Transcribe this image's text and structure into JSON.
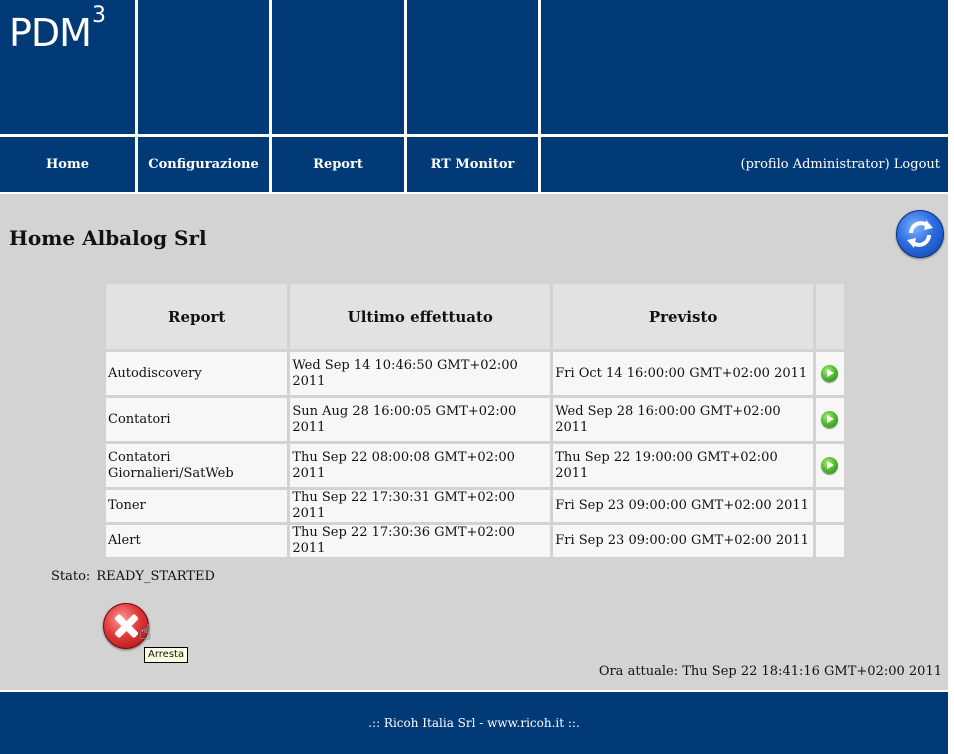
{
  "header": {
    "logo_main": "PDM",
    "logo_sup": "3"
  },
  "nav": {
    "home": "Home",
    "configurazione": "Configurazione",
    "report": "Report",
    "rt_monitor": "RT Monitor",
    "profile_text": "(profilo Administrator) ",
    "logout": "Logout"
  },
  "page": {
    "title": "Home Albalog Srl",
    "refresh_icon": "refresh-icon"
  },
  "table": {
    "columns": [
      "Report",
      "Ultimo effettuato",
      "Previsto",
      ""
    ],
    "rows": [
      {
        "report": "Autodiscovery",
        "ultimo": "Wed Sep 14 10:46:50 GMT+02:00 2011",
        "previsto": "Fri Oct 14 16:00:00 GMT+02:00 2011",
        "run_icon": "play-icon"
      },
      {
        "report": "Contatori",
        "ultimo": "Sun Aug 28 16:00:05 GMT+02:00 2011",
        "previsto": "Wed Sep 28 16:00:00 GMT+02:00 2011",
        "run_icon": "play-icon"
      },
      {
        "report": "Contatori Giornalieri/SatWeb",
        "ultimo": "Thu Sep 22 08:00:08 GMT+02:00 2011",
        "previsto": "Thu Sep 22 19:00:00 GMT+02:00 2011",
        "run_icon": "play-icon"
      },
      {
        "report": "Toner",
        "ultimo": "Thu Sep 22 17:30:31 GMT+02:00 2011",
        "previsto": "Fri Sep 23 09:00:00 GMT+02:00 2011",
        "run_icon": ""
      },
      {
        "report": "Alert",
        "ultimo": "Thu Sep 22 17:30:36 GMT+02:00 2011",
        "previsto": "Fri Sep 23 09:00:00 GMT+02:00 2011",
        "run_icon": ""
      }
    ]
  },
  "status": {
    "label": "Stato:",
    "value": "READY_STARTED"
  },
  "stop_button": {
    "icon": "stop-icon",
    "tooltip": "Arresta"
  },
  "clock": {
    "text": "Ora attuale: Thu Sep 22 18:41:16 GMT+02:00 2011"
  },
  "footer": {
    "text": ".:: Ricoh Italia Srl - www.ricoh.it ::."
  },
  "colors": {
    "brand_blue": "#023a78",
    "content_grey": "#d3d3d3"
  }
}
